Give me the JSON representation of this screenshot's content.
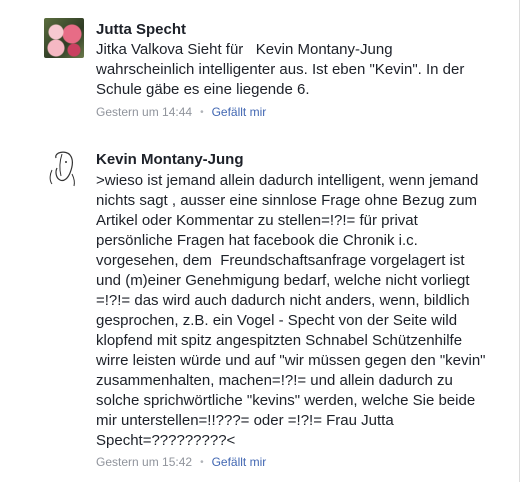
{
  "comments": [
    {
      "author": "Jutta Specht",
      "avatar_icon": "roses-photo-avatar",
      "lines": [
        "Jitka Valkova Sieht für   Kevin Montany-Jung",
        "wahrscheinlich intelligenter aus. Ist eben \"Kevin\". In der",
        "Schule gäbe es eine liegende 6."
      ],
      "timestamp": "Gestern um 14:44",
      "like_label": "Gefällt mir"
    },
    {
      "author": "Kevin Montany-Jung",
      "avatar_icon": "sketch-face-avatar",
      "lines": [
        ">wieso ist jemand allein dadurch intelligent, wenn jemand",
        "nichts sagt , ausser eine sinnlose Frage ohne Bezug zum",
        "Artikel oder Kommentar zu stellen=!?!= für privat",
        "persönliche Fragen hat facebook die Chronik i.c.",
        "vorgesehen, dem  Freundschaftsanfrage vorgelagert ist",
        "und (m)einer Genehmigung bedarf, welche nicht vorliegt",
        "=!?!= das wird auch dadurch nicht anders, wenn, bildlich",
        "gesprochen, z.B. ein Vogel - Specht von der Seite wild",
        "klopfend mit spitz angespitzten Schnabel Schützenhilfe",
        "wirre leisten würde und auf \"wir müssen gegen den \"kevin\"",
        "zusammenhalten, machen=!?!= und allein dadurch zu",
        "solche sprichwörtliche \"kevins\" werden, welche Sie beide",
        "mir unterstellen=!!???= oder =!?!= Frau Jutta",
        "Specht=?????????<"
      ],
      "timestamp": "Gestern um 15:42",
      "like_label": "Gefällt mir"
    }
  ],
  "colors": {
    "author": "#1d2129",
    "text": "#1d2129",
    "meta": "#90949c",
    "link": "#4267b2"
  }
}
